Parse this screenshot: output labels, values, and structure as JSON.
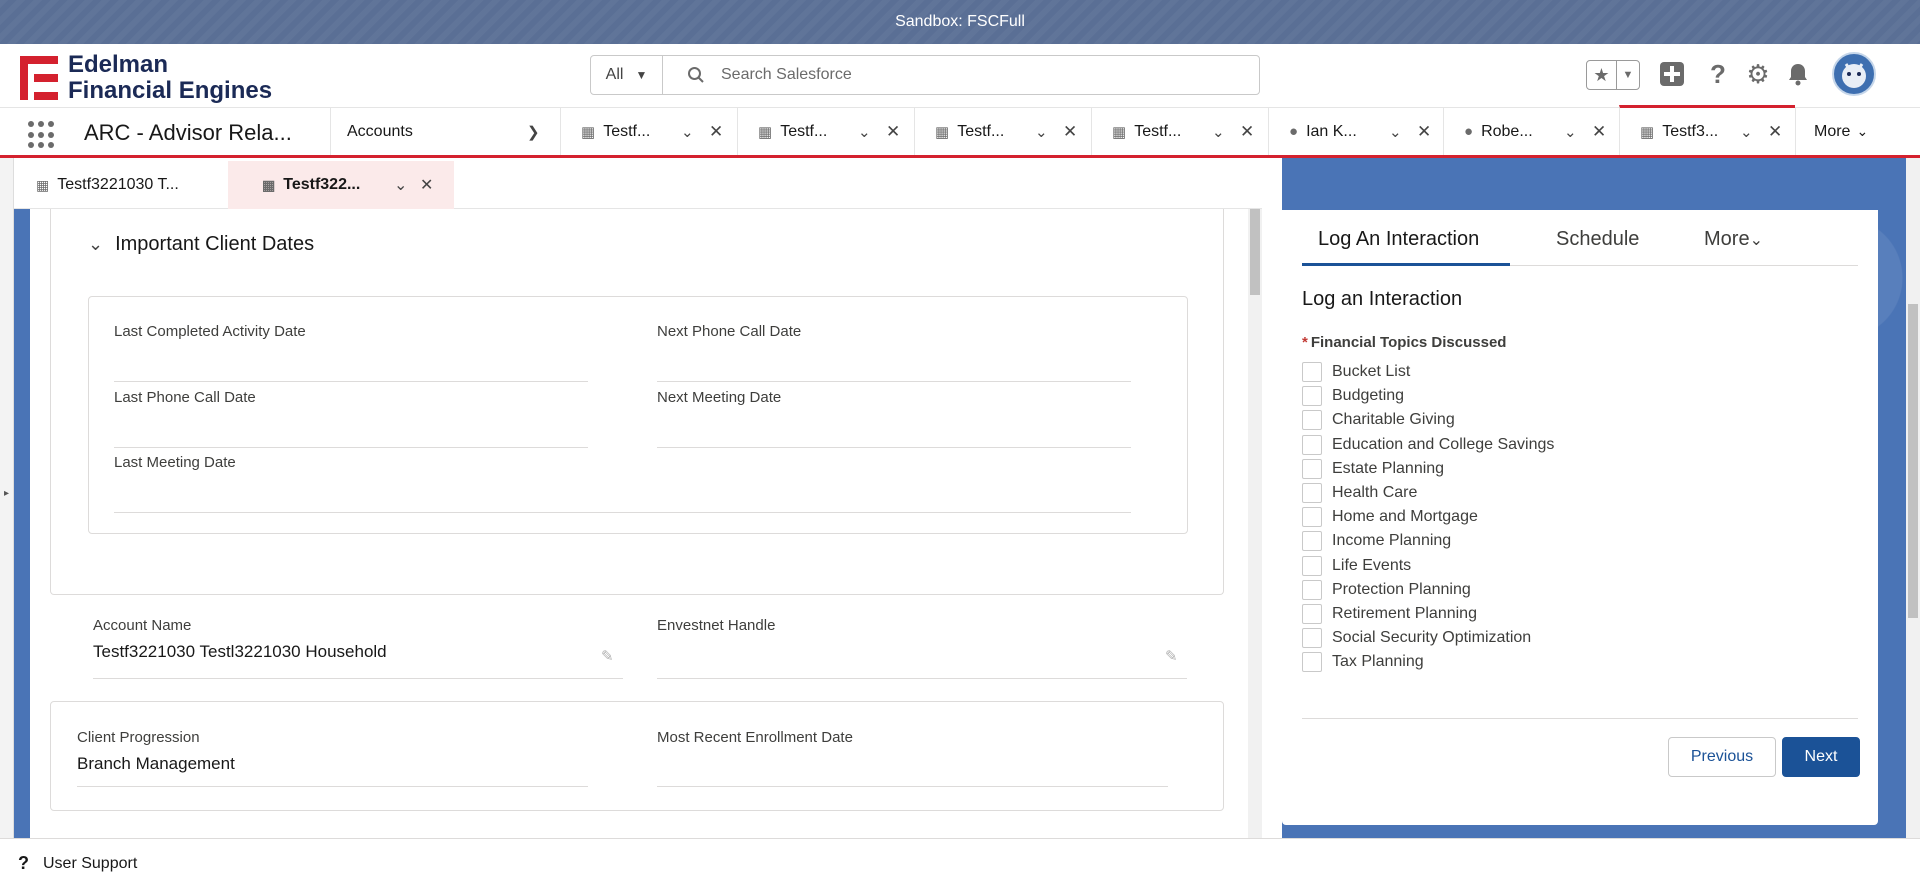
{
  "sandbox": {
    "label": "Sandbox: FSCFull"
  },
  "brand": {
    "line1": "Edelman",
    "line2": "Financial Engines",
    "color": "#d4212e"
  },
  "search": {
    "scope": "All",
    "placeholder": "Search Salesforce"
  },
  "nav": {
    "app_name": "ARC - Advisor Rela...",
    "accounts_label": "Accounts",
    "tabs": [
      {
        "label": "Testf...",
        "icon": "household-icon"
      },
      {
        "label": "Testf...",
        "icon": "household-icon"
      },
      {
        "label": "Testf...",
        "icon": "household-icon"
      },
      {
        "label": "Testf...",
        "icon": "household-icon"
      },
      {
        "label": "Ian K...",
        "icon": "person-icon"
      },
      {
        "label": "Robe...",
        "icon": "person-icon"
      },
      {
        "label": "Testf3...",
        "icon": "household-icon"
      }
    ],
    "more_label": "More"
  },
  "subtabs": [
    {
      "label": "Testf3221030 T..."
    },
    {
      "label": "Testf322..."
    }
  ],
  "main": {
    "section_title": "Important Client Dates",
    "dates": {
      "last_completed_activity": {
        "label": "Last Completed Activity Date",
        "value": ""
      },
      "next_phone_call": {
        "label": "Next Phone Call Date",
        "value": ""
      },
      "last_phone_call": {
        "label": "Last Phone Call Date",
        "value": ""
      },
      "next_meeting": {
        "label": "Next Meeting Date",
        "value": ""
      },
      "last_meeting": {
        "label": "Last Meeting Date",
        "value": ""
      }
    },
    "account_name": {
      "label": "Account Name",
      "value": "Testf3221030 Testl3221030 Household"
    },
    "envestnet_handle": {
      "label": "Envestnet Handle",
      "value": ""
    },
    "client_progression": {
      "label": "Client Progression",
      "value": "Branch Management"
    },
    "most_recent_enrollment": {
      "label": "Most Recent Enrollment Date",
      "value": ""
    }
  },
  "panel": {
    "tabs": {
      "log": "Log An Interaction",
      "schedule": "Schedule",
      "more": "More"
    },
    "heading": "Log an Interaction",
    "required_label": "Financial Topics Discussed",
    "topics": [
      "Bucket List",
      "Budgeting",
      "Charitable Giving",
      "Education and College Savings",
      "Estate Planning",
      "Health Care",
      "Home and Mortgage",
      "Income Planning",
      "Life Events",
      "Protection Planning",
      "Retirement Planning",
      "Social Security Optimization",
      "Tax Planning"
    ],
    "previous_label": "Previous",
    "next_label": "Next",
    "accent": "#1b5297"
  },
  "footer": {
    "label": "User Support"
  }
}
